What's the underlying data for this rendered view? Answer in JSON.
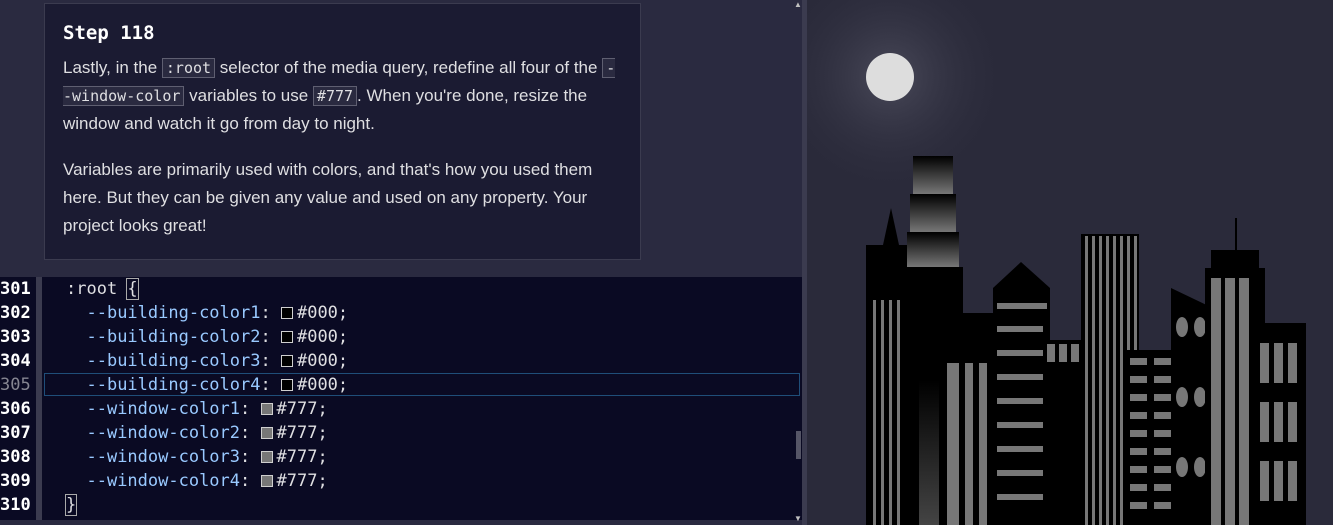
{
  "step": {
    "title": "Step 118",
    "p1_a": "Lastly, in the ",
    "p1_code1": ":root",
    "p1_b": " selector of the media query, redefine all four of the ",
    "p1_code2": "--window-color",
    "p1_c": " variables to use ",
    "p1_code3": "#777",
    "p1_d": ". When you're done, resize the window and watch it go from day to night.",
    "p2": "Variables are primarily used with colors, and that's how you used them here. But they can be given any value and used on any property. Your project looks great!"
  },
  "editor": {
    "active_line": "305",
    "lines": [
      {
        "no": "301",
        "prop": "",
        "sep": "",
        "value": "",
        "text": ":root {"
      },
      {
        "no": "302",
        "prop": "--building-color1",
        "sep": ": ",
        "value": "#000;"
      },
      {
        "no": "303",
        "prop": "--building-color2",
        "sep": ": ",
        "value": "#000;"
      },
      {
        "no": "304",
        "prop": "--building-color3",
        "sep": ": ",
        "value": "#000;"
      },
      {
        "no": "305",
        "prop": "--building-color4",
        "sep": ": ",
        "value": "#000;"
      },
      {
        "no": "306",
        "prop": "--window-color1",
        "sep": ": ",
        "value": "#777;"
      },
      {
        "no": "307",
        "prop": "--window-color2",
        "sep": ": ",
        "value": "#777;"
      },
      {
        "no": "308",
        "prop": "--window-color3",
        "sep": ": ",
        "value": "#777;"
      },
      {
        "no": "309",
        "prop": "--window-color4",
        "sep": ": ",
        "value": "#777;"
      },
      {
        "no": "310",
        "prop": "",
        "sep": "",
        "value": "",
        "text": "}"
      }
    ],
    "swatch_colors": {
      "building": "#000000",
      "window": "#777777"
    }
  },
  "colors": {
    "sky": "#2a2a3a",
    "moon": "#dddddd",
    "building": "#000000",
    "window": "#777777",
    "prop_text": "#99c9ff"
  },
  "icons": {
    "scroll_up": "scroll-up-arrow-icon",
    "scroll_down": "scroll-down-arrow-icon"
  }
}
